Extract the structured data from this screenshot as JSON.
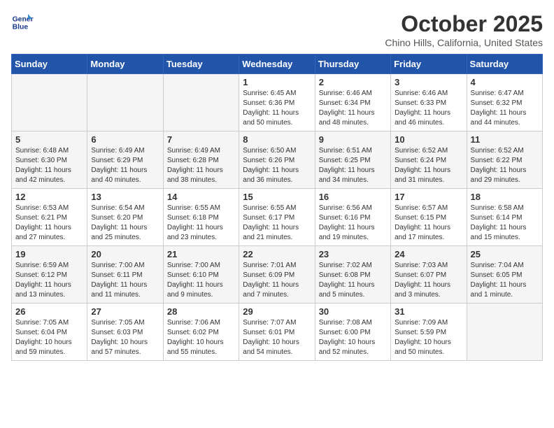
{
  "logo": {
    "line1": "General",
    "line2": "Blue"
  },
  "title": "October 2025",
  "location": "Chino Hills, California, United States",
  "weekdays": [
    "Sunday",
    "Monday",
    "Tuesday",
    "Wednesday",
    "Thursday",
    "Friday",
    "Saturday"
  ],
  "weeks": [
    [
      {
        "day": "",
        "info": ""
      },
      {
        "day": "",
        "info": ""
      },
      {
        "day": "",
        "info": ""
      },
      {
        "day": "1",
        "info": "Sunrise: 6:45 AM\nSunset: 6:36 PM\nDaylight: 11 hours\nand 50 minutes."
      },
      {
        "day": "2",
        "info": "Sunrise: 6:46 AM\nSunset: 6:34 PM\nDaylight: 11 hours\nand 48 minutes."
      },
      {
        "day": "3",
        "info": "Sunrise: 6:46 AM\nSunset: 6:33 PM\nDaylight: 11 hours\nand 46 minutes."
      },
      {
        "day": "4",
        "info": "Sunrise: 6:47 AM\nSunset: 6:32 PM\nDaylight: 11 hours\nand 44 minutes."
      }
    ],
    [
      {
        "day": "5",
        "info": "Sunrise: 6:48 AM\nSunset: 6:30 PM\nDaylight: 11 hours\nand 42 minutes."
      },
      {
        "day": "6",
        "info": "Sunrise: 6:49 AM\nSunset: 6:29 PM\nDaylight: 11 hours\nand 40 minutes."
      },
      {
        "day": "7",
        "info": "Sunrise: 6:49 AM\nSunset: 6:28 PM\nDaylight: 11 hours\nand 38 minutes."
      },
      {
        "day": "8",
        "info": "Sunrise: 6:50 AM\nSunset: 6:26 PM\nDaylight: 11 hours\nand 36 minutes."
      },
      {
        "day": "9",
        "info": "Sunrise: 6:51 AM\nSunset: 6:25 PM\nDaylight: 11 hours\nand 34 minutes."
      },
      {
        "day": "10",
        "info": "Sunrise: 6:52 AM\nSunset: 6:24 PM\nDaylight: 11 hours\nand 31 minutes."
      },
      {
        "day": "11",
        "info": "Sunrise: 6:52 AM\nSunset: 6:22 PM\nDaylight: 11 hours\nand 29 minutes."
      }
    ],
    [
      {
        "day": "12",
        "info": "Sunrise: 6:53 AM\nSunset: 6:21 PM\nDaylight: 11 hours\nand 27 minutes."
      },
      {
        "day": "13",
        "info": "Sunrise: 6:54 AM\nSunset: 6:20 PM\nDaylight: 11 hours\nand 25 minutes."
      },
      {
        "day": "14",
        "info": "Sunrise: 6:55 AM\nSunset: 6:18 PM\nDaylight: 11 hours\nand 23 minutes."
      },
      {
        "day": "15",
        "info": "Sunrise: 6:55 AM\nSunset: 6:17 PM\nDaylight: 11 hours\nand 21 minutes."
      },
      {
        "day": "16",
        "info": "Sunrise: 6:56 AM\nSunset: 6:16 PM\nDaylight: 11 hours\nand 19 minutes."
      },
      {
        "day": "17",
        "info": "Sunrise: 6:57 AM\nSunset: 6:15 PM\nDaylight: 11 hours\nand 17 minutes."
      },
      {
        "day": "18",
        "info": "Sunrise: 6:58 AM\nSunset: 6:14 PM\nDaylight: 11 hours\nand 15 minutes."
      }
    ],
    [
      {
        "day": "19",
        "info": "Sunrise: 6:59 AM\nSunset: 6:12 PM\nDaylight: 11 hours\nand 13 minutes."
      },
      {
        "day": "20",
        "info": "Sunrise: 7:00 AM\nSunset: 6:11 PM\nDaylight: 11 hours\nand 11 minutes."
      },
      {
        "day": "21",
        "info": "Sunrise: 7:00 AM\nSunset: 6:10 PM\nDaylight: 11 hours\nand 9 minutes."
      },
      {
        "day": "22",
        "info": "Sunrise: 7:01 AM\nSunset: 6:09 PM\nDaylight: 11 hours\nand 7 minutes."
      },
      {
        "day": "23",
        "info": "Sunrise: 7:02 AM\nSunset: 6:08 PM\nDaylight: 11 hours\nand 5 minutes."
      },
      {
        "day": "24",
        "info": "Sunrise: 7:03 AM\nSunset: 6:07 PM\nDaylight: 11 hours\nand 3 minutes."
      },
      {
        "day": "25",
        "info": "Sunrise: 7:04 AM\nSunset: 6:05 PM\nDaylight: 11 hours\nand 1 minute."
      }
    ],
    [
      {
        "day": "26",
        "info": "Sunrise: 7:05 AM\nSunset: 6:04 PM\nDaylight: 10 hours\nand 59 minutes."
      },
      {
        "day": "27",
        "info": "Sunrise: 7:05 AM\nSunset: 6:03 PM\nDaylight: 10 hours\nand 57 minutes."
      },
      {
        "day": "28",
        "info": "Sunrise: 7:06 AM\nSunset: 6:02 PM\nDaylight: 10 hours\nand 55 minutes."
      },
      {
        "day": "29",
        "info": "Sunrise: 7:07 AM\nSunset: 6:01 PM\nDaylight: 10 hours\nand 54 minutes."
      },
      {
        "day": "30",
        "info": "Sunrise: 7:08 AM\nSunset: 6:00 PM\nDaylight: 10 hours\nand 52 minutes."
      },
      {
        "day": "31",
        "info": "Sunrise: 7:09 AM\nSunset: 5:59 PM\nDaylight: 10 hours\nand 50 minutes."
      },
      {
        "day": "",
        "info": ""
      }
    ]
  ]
}
